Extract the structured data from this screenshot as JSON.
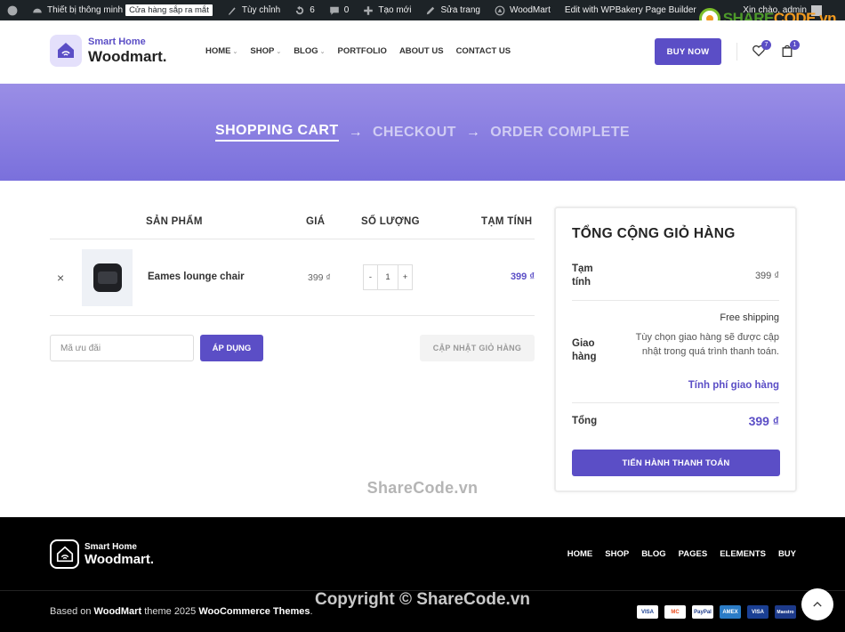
{
  "adminbar": {
    "site_name": "Thiết bị thông minh",
    "store_badge": "Cửa hàng sắp ra mắt",
    "customize": "Tùy chỉnh",
    "updates": "6",
    "comments": "0",
    "new": "Tạo mới",
    "edit_page": "Sửa trang",
    "woodmart": "WoodMart",
    "wpbakery": "Edit with WPBakery Page Builder",
    "greeting": "Xin chào, admin"
  },
  "watermark_logo": {
    "part1": "SHARE",
    "part2": "CODE.vn"
  },
  "header": {
    "brand_small": "Smart Home",
    "brand_big": "Woodmart.",
    "nav": [
      "HOME",
      "SHOP",
      "BLOG",
      "PORTFOLIO",
      "ABOUT US",
      "CONTACT US"
    ],
    "buy_now": "BUY NOW",
    "wishlist_count": "7",
    "cart_count": "1"
  },
  "steps": {
    "cart": "SHOPPING CART",
    "arrow": "→",
    "checkout": "CHECKOUT",
    "complete": "ORDER COMPLETE"
  },
  "cart": {
    "headers": {
      "product": "SẢN PHẨM",
      "price": "GIÁ",
      "qty": "SỐ LƯỢNG",
      "subtotal": "TẠM TÍNH"
    },
    "item": {
      "remove": "×",
      "name": "Eames lounge chair",
      "price": "399 ₫",
      "minus": "-",
      "qty": "1",
      "plus": "+",
      "subtotal": "399 ₫"
    },
    "coupon_placeholder": "Mã ưu đãi",
    "apply": "ÁP DỤNG",
    "update": "CẬP NHẬT GIỎ HÀNG"
  },
  "totals": {
    "title": "TỔNG CỘNG GIỎ HÀNG",
    "subtotal_label": "Tạm tính",
    "subtotal_value": "399 ₫",
    "shipping_label": "Giao hàng",
    "shipping_method": "Free shipping",
    "shipping_note": "Tùy chọn giao hàng sẽ được cập nhật trong quá trình thanh toán.",
    "shipping_calc": "Tính phí giao hàng",
    "total_label": "Tổng",
    "total_value": "399 ₫",
    "checkout": "TIẾN HÀNH THANH TOÁN"
  },
  "watermarks": {
    "middle": "ShareCode.vn",
    "footer": "Copyright © ShareCode.vn"
  },
  "footer": {
    "brand_small": "Smart Home",
    "brand_big": "Woodmart.",
    "nav": [
      "HOME",
      "SHOP",
      "BLOG",
      "PAGES",
      "ELEMENTS",
      "BUY"
    ],
    "copy_prefix": "Based on",
    "copy_brand": "WoodMart",
    "copy_mid": "theme 2025",
    "copy_wc": "WooCommerce Themes",
    "copy_end": ".",
    "cards": [
      "VISA",
      "MC",
      "PayPal",
      "AMEX",
      "VISA",
      "Maestro"
    ]
  },
  "colors": {
    "accent": "#5b4ec6",
    "banner_top": "#9a8ee6",
    "banner_bottom": "#7a70dc",
    "admin_bar": "#1d2327"
  }
}
